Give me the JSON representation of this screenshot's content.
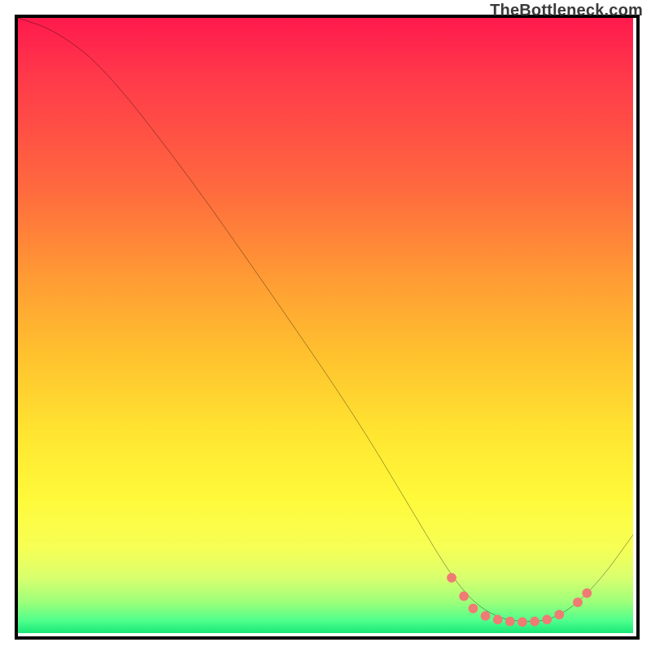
{
  "watermark": "TheBottleneck.com",
  "colors": {
    "curve_stroke": "#000000",
    "marker_fill": "#f07a74",
    "marker_stroke": "#f07a74"
  },
  "chart_data": {
    "type": "line",
    "title": "",
    "xlabel": "",
    "ylabel": "",
    "xlim": [
      0,
      100
    ],
    "ylim": [
      0,
      100
    ],
    "grid": false,
    "legend": false,
    "curve": [
      {
        "x": 0,
        "y": 100
      },
      {
        "x": 6,
        "y": 98
      },
      {
        "x": 14,
        "y": 92
      },
      {
        "x": 28,
        "y": 74
      },
      {
        "x": 42,
        "y": 54
      },
      {
        "x": 55,
        "y": 35
      },
      {
        "x": 64,
        "y": 20
      },
      {
        "x": 70,
        "y": 10
      },
      {
        "x": 74,
        "y": 5
      },
      {
        "x": 78,
        "y": 2.5
      },
      {
        "x": 82,
        "y": 1.8
      },
      {
        "x": 86,
        "y": 2.0
      },
      {
        "x": 90,
        "y": 4
      },
      {
        "x": 95,
        "y": 9
      },
      {
        "x": 100,
        "y": 16
      }
    ],
    "markers": [
      {
        "x": 70.5,
        "y": 9.0
      },
      {
        "x": 72.5,
        "y": 6.0
      },
      {
        "x": 74.0,
        "y": 4.0
      },
      {
        "x": 76.0,
        "y": 2.8
      },
      {
        "x": 78.0,
        "y": 2.2
      },
      {
        "x": 80.0,
        "y": 1.9
      },
      {
        "x": 82.0,
        "y": 1.8
      },
      {
        "x": 84.0,
        "y": 1.9
      },
      {
        "x": 86.0,
        "y": 2.2
      },
      {
        "x": 88.0,
        "y": 3.0
      },
      {
        "x": 91.0,
        "y": 5.0
      },
      {
        "x": 92.5,
        "y": 6.5
      }
    ]
  }
}
